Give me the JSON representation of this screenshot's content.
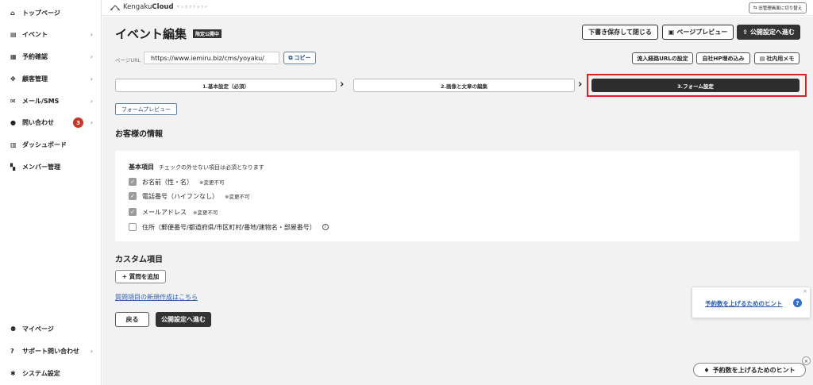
{
  "sidebar": {
    "items": [
      {
        "icon": "home-icon",
        "glyph": "⌂",
        "label": "トップページ"
      },
      {
        "icon": "document-icon",
        "glyph": "▤",
        "label": "イベント",
        "chevron": "›"
      },
      {
        "icon": "calendar-icon",
        "glyph": "▦",
        "label": "予約確認",
        "chevron": "›"
      },
      {
        "icon": "users-icon",
        "glyph": "✥",
        "label": "顧客管理",
        "chevron": "›"
      },
      {
        "icon": "mail-icon",
        "glyph": "✉",
        "label": "メール/SMS",
        "chevron": "›"
      },
      {
        "icon": "chat-icon",
        "glyph": "●",
        "label": "問い合わせ",
        "badge": "3",
        "chevron": "›"
      },
      {
        "icon": "chart-icon",
        "glyph": "▥",
        "label": "ダッシュボード"
      },
      {
        "icon": "grid-icon",
        "glyph": "▚",
        "label": "メンバー管理"
      }
    ],
    "bottom": [
      {
        "icon": "person-icon",
        "glyph": "⚉",
        "label": "マイページ"
      },
      {
        "icon": "help-icon",
        "glyph": "?",
        "label": "サポート問い合わせ",
        "chevron": "›"
      },
      {
        "icon": "gear-icon",
        "glyph": "✱",
        "label": "システム設定"
      }
    ]
  },
  "header": {
    "logo_prefix": "Kengaku",
    "logo_bold": "Cloud",
    "logo_tagline": "ケンガククラウド",
    "switch_label": "旧管理画面に切り替え"
  },
  "page": {
    "title": "イベント編集",
    "status": "限定公開中",
    "save_close": "下書き保存して閉じる",
    "page_preview": "ページプレビュー",
    "publish_next": "公開設定へ進む"
  },
  "url_bar": {
    "label": "ページURL",
    "value": "https://www.iemiru.biz/cms/yoyaku/",
    "copy": "コピー",
    "traffic_url": "流入経路URLの設定",
    "embed": "自社HP埋め込み",
    "memo": "社内用メモ"
  },
  "steps": [
    "1.基本設定（必須）",
    "2.画像と文章の編集",
    "3.フォーム設定"
  ],
  "form": {
    "preview_button": "フォームプレビュー",
    "customer_section": "お客様の情報",
    "basic_label": "基本項目",
    "basic_note": "チェックの外せない項目は必須となります",
    "fields": [
      {
        "label": "お名前（性・名）",
        "note": "※変更不可",
        "checked": true
      },
      {
        "label": "電話番号（ハイフンなし）",
        "note": "※変更不可",
        "checked": true
      },
      {
        "label": "メールアドレス",
        "note": "※変更不可",
        "checked": true
      },
      {
        "label": "住所（郵便番号/都道府県/市区町村/番地/建物名・部屋番号）",
        "note": "",
        "checked": false
      }
    ],
    "custom_section": "カスタム項目",
    "add_question": "+ 質問を追加",
    "new_question_link": "質問項目の新規作成はこちら",
    "back": "戻る",
    "publish_next": "公開設定へ進む"
  },
  "hints": {
    "card_link": "予約数を上げるためのヒント",
    "pill": "予約数を上げるためのヒント"
  },
  "colors": {
    "accent": "#2f6fd6",
    "dark": "#333333",
    "badge": "#c0392b",
    "highlight": "#e02020"
  }
}
